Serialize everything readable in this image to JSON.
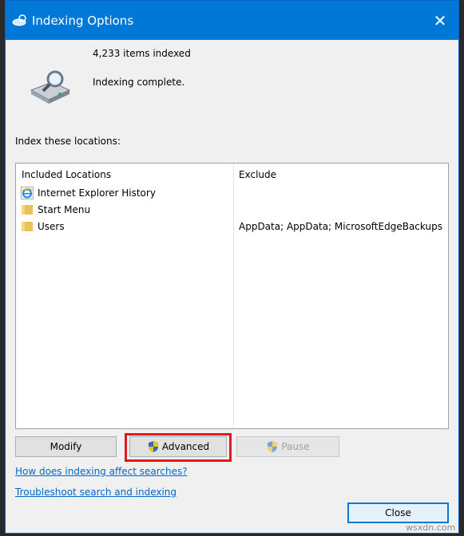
{
  "window": {
    "title": "Indexing Options",
    "close_glyph": "✕",
    "title_icon": "indexing-icon"
  },
  "status": {
    "items_indexed": "4,233 items indexed",
    "message": "Indexing complete.",
    "icon": "drive-magnifier-icon"
  },
  "locations": {
    "label": "Index these locations:",
    "columns": [
      "Included Locations",
      "Exclude"
    ],
    "rows": [
      {
        "name": "Internet Explorer History",
        "exclude": "",
        "icon": "ie-icon"
      },
      {
        "name": "Start Menu",
        "exclude": "",
        "icon": "folder-icon"
      },
      {
        "name": "Users",
        "exclude": "AppData; AppData; MicrosoftEdgeBackups",
        "icon": "folder-icon"
      }
    ]
  },
  "buttons": {
    "modify": "Modify",
    "advanced": "Advanced",
    "pause": "Pause",
    "close": "Close"
  },
  "links": {
    "how": "How does indexing affect searches?",
    "troubleshoot": "Troubleshoot search and indexing"
  },
  "watermark": "wsxdn.com",
  "colors": {
    "titlebar": "#0078d7",
    "highlight": "#e01a1a",
    "link": "#0066cc"
  }
}
